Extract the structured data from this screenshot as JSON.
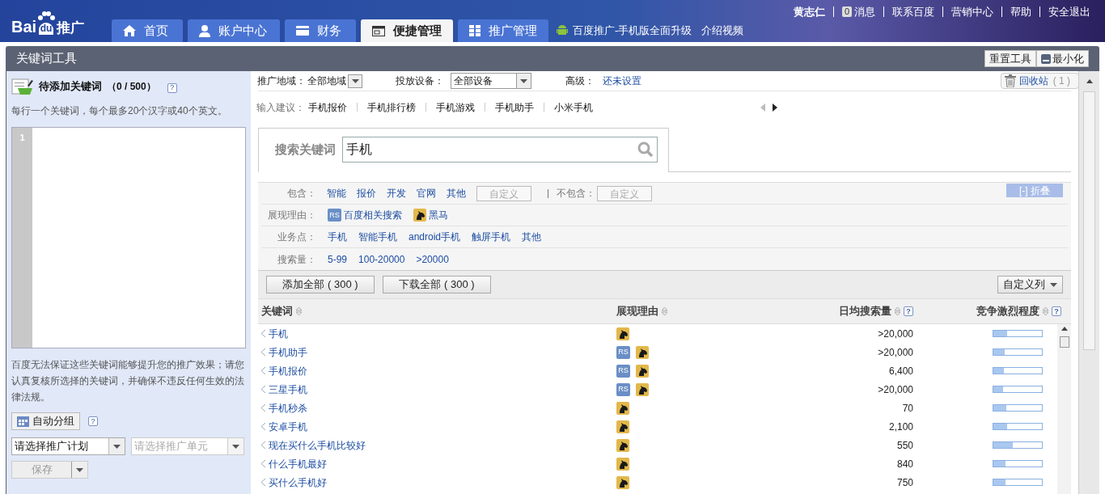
{
  "header": {
    "logo": {
      "before": "Bai",
      "paw": "du",
      "after": "推广"
    },
    "nav_tabs": [
      {
        "kind": "home",
        "label": "首页",
        "selected": false
      },
      {
        "kind": "user",
        "label": "账户中心",
        "selected": false
      },
      {
        "kind": "card",
        "label": "财务",
        "selected": false
      },
      {
        "kind": "window",
        "label": "便捷管理",
        "selected": true
      },
      {
        "kind": "grid",
        "label": "推广管理",
        "selected": false
      }
    ],
    "promo": {
      "text": "百度推广-手机版全面升级",
      "link": "介绍视频"
    },
    "user_name": "黄志仁",
    "message_count": "0",
    "message_label": "消息",
    "links": [
      "联系百度",
      "营销中心",
      "帮助",
      "安全退出"
    ]
  },
  "tool": {
    "title": "关键词工具",
    "buttons": [
      {
        "kind": "plain",
        "label": "重置工具"
      },
      {
        "kind": "minimize",
        "label": "最小化"
      }
    ]
  },
  "left_panel": {
    "title": "待添加关键词",
    "count": "（0 / 500）",
    "help": "?",
    "hint": "每行一个关键词，每个最多20个汉字或40个英文。",
    "line_number": "1",
    "disclaimer": "百度无法保证这些关键词能够提升您的推广效果；请您认真复核所选择的关键词，并确保不违反任何生效的法律法规。",
    "auto_group": "自动分组",
    "auto_group_help": "?",
    "plan_select": "请选择推广计划",
    "unit_select_placeholder": "请选择推广单元",
    "save": "保存"
  },
  "settings": {
    "region_label": "推广地域：",
    "region": "全部地域",
    "device_label": "投放设备：",
    "device": "全部设备",
    "advanced_label": "高级：",
    "advanced_link": "还未设置",
    "recycle_label": "回收站",
    "recycle_count": "( 1 )"
  },
  "suggestions": {
    "label": "输入建议：",
    "items": [
      "手机报价",
      "手机排行榜",
      "手机游戏",
      "手机助手",
      "小米手机"
    ]
  },
  "search": {
    "tab_label": "搜索关键词",
    "value": "手机"
  },
  "filters": {
    "collapse": "[-] 折叠",
    "include_label": "包含：",
    "include": [
      "智能",
      "报价",
      "开发",
      "官网",
      "其他"
    ],
    "include_custom": "自定义",
    "exclude_label": "不包含：",
    "exclude_custom": "自定义",
    "reason_label": "展现理由：",
    "reasons": [
      {
        "kind": "rs",
        "badge": "RS",
        "label": "百度相关搜索"
      },
      {
        "kind": "horse",
        "label": "黑马"
      }
    ],
    "business_label": "业务点：",
    "business": [
      "手机",
      "智能手机",
      "android手机",
      "触屏手机",
      "其他"
    ],
    "volume_label": "搜索量：",
    "volume": [
      "5-99",
      "100-20000",
      ">20000"
    ]
  },
  "actions": {
    "add_all": "添加全部 ( 300 )",
    "download_all": "下载全部 ( 300 )",
    "columns": "自定义列"
  },
  "table": {
    "columns": [
      {
        "label": "关键词",
        "help": false
      },
      {
        "label": "展现理由",
        "help": false
      },
      {
        "label": "日均搜索量",
        "help": true
      },
      {
        "label": "竞争激烈程度",
        "help": true
      }
    ],
    "help": "?",
    "rows": [
      {
        "keyword": "手机",
        "reasons": [
          {
            "kind": "horse"
          }
        ],
        "volume": ">20,000",
        "level": 0.28
      },
      {
        "keyword": "手机助手",
        "reasons": [
          {
            "kind": "rs",
            "badge": "RS"
          },
          {
            "kind": "horse"
          }
        ],
        "volume": ">20,000",
        "level": 0.23
      },
      {
        "keyword": "手机报价",
        "reasons": [
          {
            "kind": "rs",
            "badge": "RS"
          },
          {
            "kind": "horse"
          }
        ],
        "volume": "6,400",
        "level": 0.22
      },
      {
        "keyword": "三星手机",
        "reasons": [
          {
            "kind": "rs",
            "badge": "RS"
          },
          {
            "kind": "horse"
          }
        ],
        "volume": ">20,000",
        "level": 0.2
      },
      {
        "keyword": "手机秒杀",
        "reasons": [
          {
            "kind": "horse"
          }
        ],
        "volume": "70",
        "level": 0.27
      },
      {
        "keyword": "安卓手机",
        "reasons": [
          {
            "kind": "horse"
          }
        ],
        "volume": "2,100",
        "level": 0.28
      },
      {
        "keyword": "现在买什么手机比较好",
        "reasons": [
          {
            "kind": "horse"
          }
        ],
        "volume": "550",
        "level": 0.4
      },
      {
        "keyword": "什么手机最好",
        "reasons": [
          {
            "kind": "horse"
          }
        ],
        "volume": "840",
        "level": 0.25
      },
      {
        "keyword": "买什么手机好",
        "reasons": [
          {
            "kind": "horse"
          }
        ],
        "volume": "750",
        "level": 0.25
      }
    ]
  }
}
